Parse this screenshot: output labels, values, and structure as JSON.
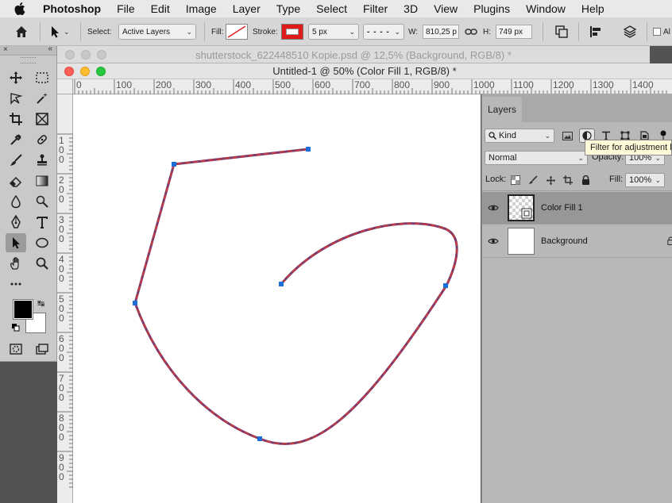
{
  "menubar": {
    "app": "Photoshop",
    "items": [
      "File",
      "Edit",
      "Image",
      "Layer",
      "Type",
      "Select",
      "Filter",
      "3D",
      "View",
      "Plugins",
      "Window",
      "Help"
    ]
  },
  "options": {
    "select_label": "Select:",
    "select_value": "Active Layers",
    "fill_label": "Fill:",
    "stroke_label": "Stroke:",
    "stroke_width": "5 px",
    "w_label": "W:",
    "w_value": "810,25 p",
    "h_label": "H:",
    "h_value": "749 px",
    "align_label": "Al"
  },
  "documents": {
    "background_tab": "shutterstock_622448510 Kopie.psd @ 12,5% (Background, RGB/8) *",
    "active_title": "Untitled-1 @ 50% (Color Fill 1, RGB/8) *"
  },
  "rulers": {
    "horizontal": [
      "0",
      "100",
      "200",
      "300",
      "400",
      "500",
      "600",
      "700",
      "800",
      "900",
      "1000",
      "1100",
      "1200",
      "1300",
      "1400"
    ],
    "vertical": [
      "1\n0\n0",
      "2\n0\n0",
      "3\n0\n0",
      "4\n0\n0",
      "5\n0\n0",
      "6\n0\n0",
      "7\n0\n0",
      "8\n0\n0",
      "9\n0\n0"
    ]
  },
  "layers_panel": {
    "tab": "Layers",
    "kind_label": "Kind",
    "blend_mode": "Normal",
    "opacity_label": "Opacity:",
    "opacity_value": "100%",
    "lock_label": "Lock:",
    "fill_label": "Fill:",
    "fill_value": "100%",
    "tooltip": "Filter for adjustment layers",
    "layers": [
      {
        "name": "Color Fill 1",
        "selected": true,
        "visible": true
      },
      {
        "name": "Background",
        "selected": false,
        "visible": true,
        "locked": true
      }
    ]
  },
  "colors": {
    "path_stroke": "#7b3a6a",
    "path_dash": "#d23a3a",
    "anchor": "#1a6fd8",
    "foreground": "#000000",
    "background": "#ffffff"
  }
}
